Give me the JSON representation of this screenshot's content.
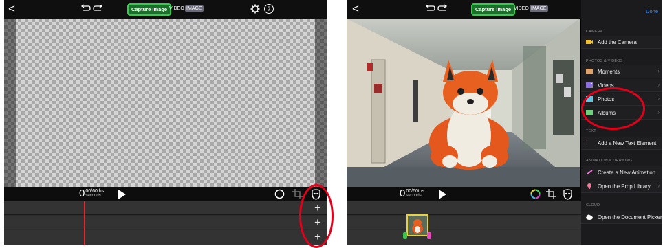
{
  "left": {
    "top_bar": {
      "back_label": "<",
      "capture_label": "Capture Image",
      "mode_video": "VIDEO",
      "mode_image": "IMAGE",
      "settings_icon": "gear-icon",
      "help_label": "?"
    },
    "controls": {
      "time_value": "0",
      "time_unit": "00/60ths",
      "time_seconds": "seconds"
    },
    "tracks": [
      "+",
      "+",
      "+"
    ]
  },
  "right": {
    "top_bar": {
      "back_label": "<",
      "capture_label": "Capture Image",
      "mode_video": "VIDEO",
      "mode_image": "IMAGE"
    },
    "controls": {
      "time_value": "0",
      "time_unit": "00/60ths",
      "time_seconds": "seconds"
    },
    "menu": {
      "done_label": "Done",
      "sections": {
        "camera": "CAMERA",
        "photos_videos": "PHOTOS & VIDEOS",
        "text": "TEXT",
        "animation": "ANIMATION & DRAWING",
        "cloud": "CLOUD"
      },
      "items": {
        "add_camera": "Add the Camera",
        "moments": "Moments",
        "videos": "Videos",
        "photos": "Photos",
        "albums": "Albums",
        "add_text": "Add a New Text Element",
        "create_animation": "Create a New Animation",
        "prop_library": "Open the Prop Library",
        "document_picker": "Open the Document Picker"
      }
    }
  },
  "colors": {
    "capture_green": "#2bd04b",
    "playhead_red": "#e0282b",
    "done_blue": "#3e8ef7",
    "annotation_red": "#e4001a",
    "thumb_border": "#e8d23a"
  }
}
